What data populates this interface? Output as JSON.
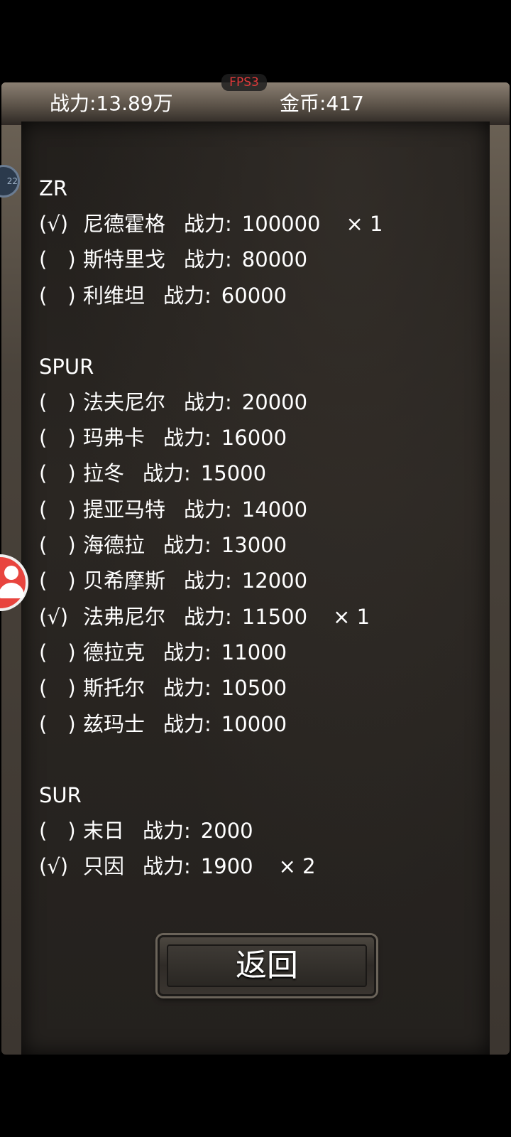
{
  "fps": "FPS3",
  "header": {
    "power": "战力:13.89万",
    "gold": "金币:417"
  },
  "side_bubble_text": "22",
  "return_label": "返回",
  "power_label": "战力:",
  "sections": [
    {
      "title": "ZR",
      "rows": [
        {
          "check": "(√)",
          "name": "尼德霍格",
          "value": "100000",
          "qty": "× 1"
        },
        {
          "check": "(　)",
          "name": "斯特里戈",
          "value": "80000",
          "qty": ""
        },
        {
          "check": "(　)",
          "name": "利维坦",
          "value": "60000",
          "qty": ""
        }
      ]
    },
    {
      "title": "SPUR",
      "rows": [
        {
          "check": "(　)",
          "name": "法夫尼尔",
          "value": "20000",
          "qty": ""
        },
        {
          "check": "(　)",
          "name": "玛弗卡",
          "value": "16000",
          "qty": ""
        },
        {
          "check": "(　)",
          "name": "拉冬",
          "value": "15000",
          "qty": ""
        },
        {
          "check": "(　)",
          "name": "提亚马特",
          "value": "14000",
          "qty": ""
        },
        {
          "check": "(　)",
          "name": "海德拉",
          "value": "13000",
          "qty": ""
        },
        {
          "check": "(　)",
          "name": "贝希摩斯",
          "value": "12000",
          "qty": ""
        },
        {
          "check": "(√)",
          "name": "法弗尼尔",
          "value": "11500",
          "qty": "× 1"
        },
        {
          "check": "(　)",
          "name": "德拉克",
          "value": "11000",
          "qty": ""
        },
        {
          "check": "(　)",
          "name": "斯托尔",
          "value": "10500",
          "qty": ""
        },
        {
          "check": "(　)",
          "name": "兹玛士",
          "value": "10000",
          "qty": ""
        }
      ]
    },
    {
      "title": "SUR",
      "rows": [
        {
          "check": "(　)",
          "name": "末日",
          "value": "2000",
          "qty": ""
        },
        {
          "check": "(√)",
          "name": "只因",
          "value": "1900",
          "qty": "× 2"
        }
      ]
    }
  ]
}
